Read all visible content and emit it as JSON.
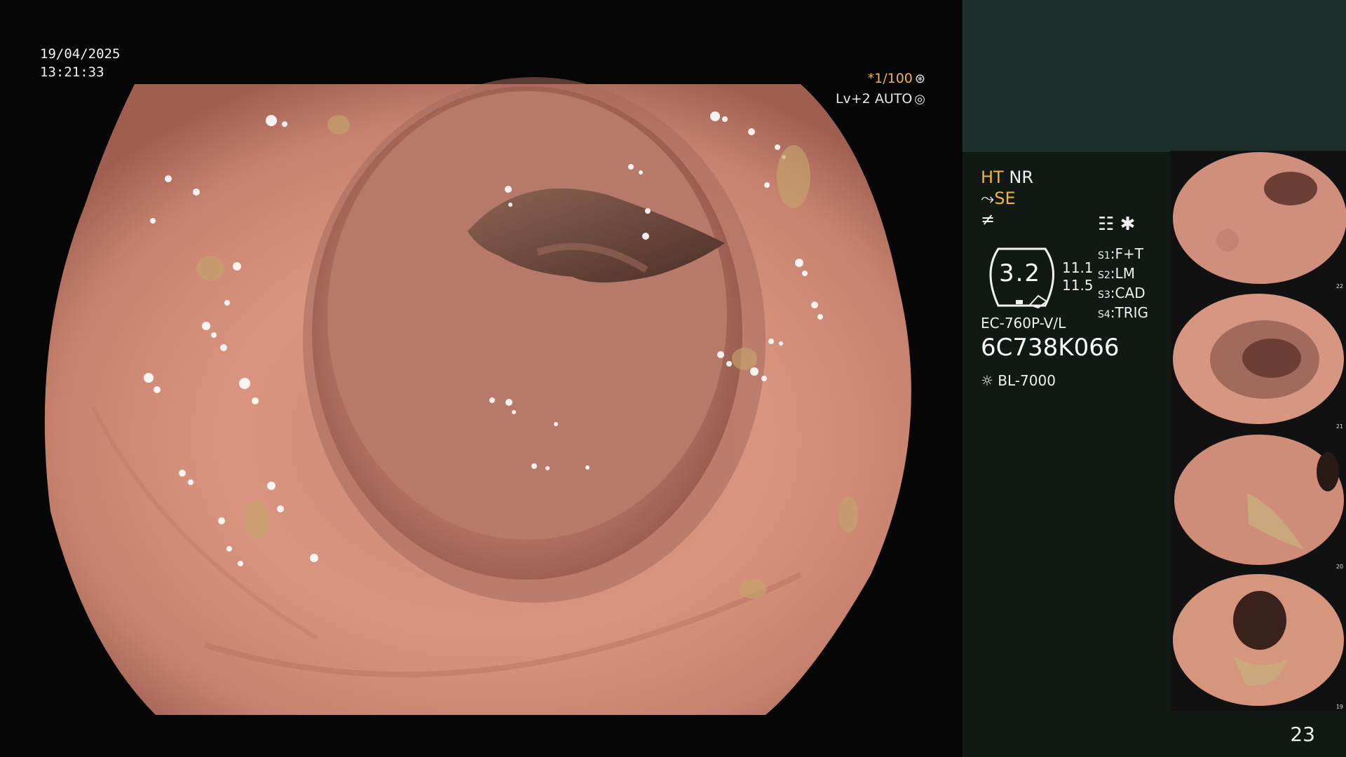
{
  "overlay": {
    "date": "19/04/2025",
    "time": "13:21:33",
    "shutter": "*1/100",
    "level": "Lv+2 AUTO"
  },
  "settings": {
    "ht": "HT",
    "nr": "NR",
    "se": "SE",
    "badge_value": "3.2",
    "num1": "11.1",
    "num2": "11.5",
    "s1": {
      "key": "S1",
      "value": "F+T"
    },
    "s2": {
      "key": "S2",
      "value": "LM"
    },
    "s3": {
      "key": "S3",
      "value": "CAD"
    },
    "s4": {
      "key": "S4",
      "value": "TRIG"
    },
    "model": "EC-760P-V/L",
    "serial": "6C738K066",
    "light_source": "BL-7000"
  },
  "thumbnails": [
    {
      "index": "22"
    },
    {
      "index": "21"
    },
    {
      "index": "20"
    },
    {
      "index": "19"
    }
  ],
  "page_number": "23",
  "colors": {
    "background": "#050505",
    "panel": "#111915",
    "teal_box": "#1b2e2a",
    "accent_gold": "#f0b43a",
    "mucosa": "#d68f7b"
  }
}
